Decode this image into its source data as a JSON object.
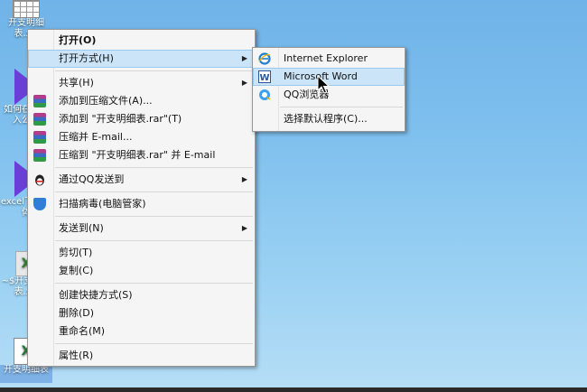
{
  "desktop": {
    "icons": [
      {
        "label": "开支明细表.xls"
      },
      {
        "label": "如何在中插入公式"
      },
      {
        "label": "excel下拉字体"
      },
      {
        "label": "~$开支明细表.xls"
      },
      {
        "label": "开支明细表"
      }
    ]
  },
  "context_menu": {
    "open": "打开(O)",
    "open_with": "打开方式(H)",
    "share": "共享(H)",
    "add_archive": "添加到压缩文件(A)...",
    "add_to_rar": "添加到 \"开支明细表.rar\"(T)",
    "compress_email": "压缩并 E-mail...",
    "compress_rar_email": "压缩到 \"开支明细表.rar\" 并 E-mail",
    "send_qq": "通过QQ发送到",
    "scan_virus": "扫描病毒(电脑管家)",
    "send_to": "发送到(N)",
    "cut": "剪切(T)",
    "copy": "复制(C)",
    "create_shortcut": "创建快捷方式(S)",
    "delete": "删除(D)",
    "rename": "重命名(M)",
    "properties": "属性(R)"
  },
  "submenu": {
    "ie": "Internet Explorer",
    "word": "Microsoft Word",
    "qq_browser": "QQ浏览器",
    "choose_default": "选择默认程序(C)..."
  },
  "colors": {
    "ie_blue": "#1f7fd1",
    "word_blue": "#2b5797",
    "highlight": "#cce4f7"
  }
}
